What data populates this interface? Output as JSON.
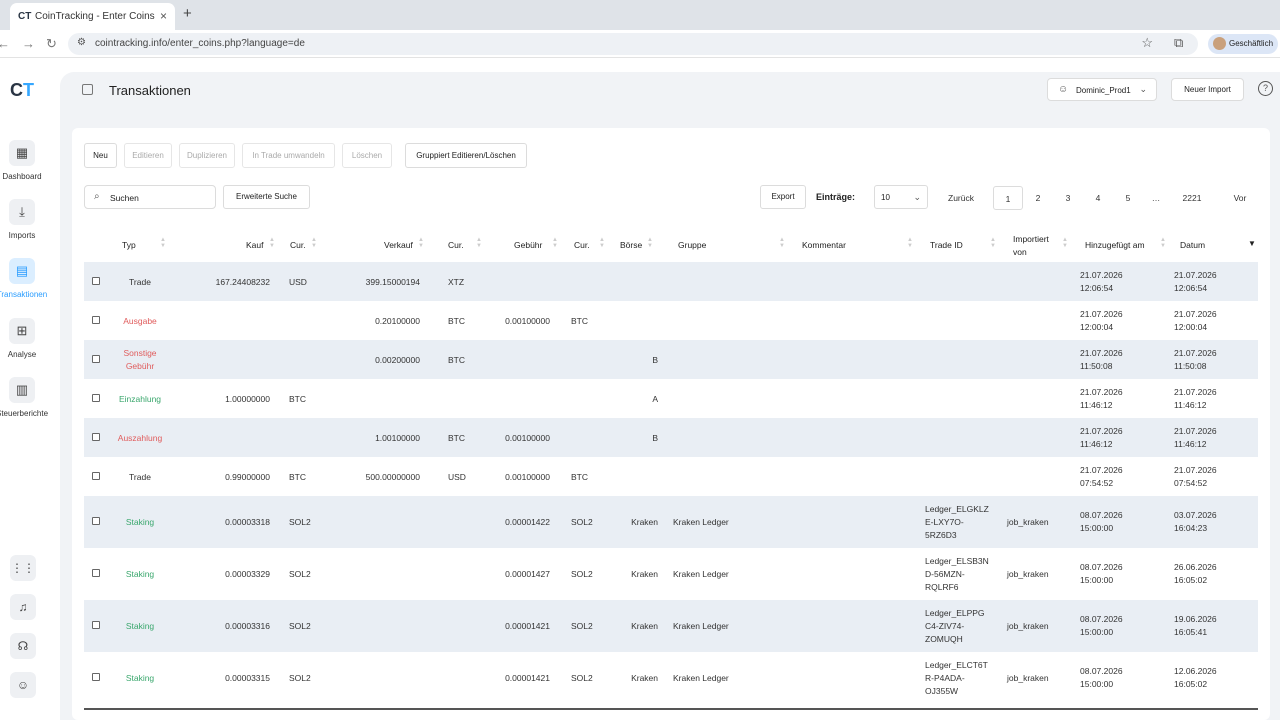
{
  "browser": {
    "tab_title": "CoinTracking - Enter Coins",
    "tab_favicon": "CT",
    "url": "cointracking.info/enter_coins.php?language=de",
    "profile_label": "Geschäftlich"
  },
  "app": {
    "logo_c": "C",
    "logo_t": "T",
    "page_title": "Transaktionen",
    "user_name": "Dominic_Prod1",
    "new_import_label": "Neuer Import",
    "help_label": "?",
    "accent_color": "#35a7ff"
  },
  "sidebar": {
    "items": [
      {
        "label": "Dashboard",
        "icon": "dashboard-grid-icon"
      },
      {
        "label": "Imports",
        "icon": "download-icon"
      },
      {
        "label": "Transaktionen",
        "icon": "transactions-icon"
      },
      {
        "label": "Analyse",
        "icon": "chart-presentation-icon"
      },
      {
        "label": "Steuerberichte",
        "icon": "bar-chart-icon"
      }
    ],
    "bottom_icons": [
      "apps-grid-icon",
      "bell-icon",
      "headset-icon",
      "user-icon"
    ]
  },
  "toolbar": {
    "new": "Neu",
    "edit": "Editieren",
    "duplicate": "Duplizieren",
    "convert": "In Trade umwandeln",
    "delete": "Löschen",
    "group_edit": "Gruppiert Editieren/Löschen",
    "search_placeholder": "Suchen",
    "advanced_search": "Erweiterte Suche",
    "export": "Export",
    "entries_label": "Einträge:",
    "entries_value": "10",
    "prev": "Zurück",
    "pages": [
      "1",
      "2",
      "3",
      "4",
      "5",
      "…",
      "2221"
    ],
    "next": "Vor"
  },
  "table": {
    "headers": {
      "type": "Typ",
      "buy": "Kauf",
      "buy_cur": "Cur.",
      "sell": "Verkauf",
      "sell_cur": "Cur.",
      "fee": "Gebühr",
      "fee_cur": "Cur.",
      "exchange": "Börse",
      "group": "Gruppe",
      "comment": "Kommentar",
      "trade_id": "Trade ID",
      "imported_1": "Importiert",
      "imported_2": "von",
      "added": "Hinzugefügt am",
      "date": "Datum"
    },
    "rows": [
      {
        "type": "Trade",
        "type2": "",
        "buy": "167.24408232",
        "buy_cur": "USD",
        "sell": "399.15000194",
        "sell_cur": "XTZ",
        "fee": "",
        "fee_cur": "",
        "exchange": "",
        "group": "",
        "comment": "",
        "tid1": "",
        "tid2": "",
        "tid3": "",
        "imported": "",
        "added_d": "21.07.2026",
        "added_t": "12:06:54",
        "date_d": "21.07.2026",
        "date_t": "12:06:54"
      },
      {
        "type": "Ausgabe",
        "type2": "",
        "buy": "",
        "buy_cur": "",
        "sell": "0.20100000",
        "sell_cur": "BTC",
        "fee": "0.00100000",
        "fee_cur": "BTC",
        "exchange": "",
        "group": "",
        "comment": "",
        "tid1": "",
        "tid2": "",
        "tid3": "",
        "imported": "",
        "added_d": "21.07.2026",
        "added_t": "12:00:04",
        "date_d": "21.07.2026",
        "date_t": "12:00:04"
      },
      {
        "type": "Sonstige",
        "type2": "Gebühr",
        "buy": "",
        "buy_cur": "",
        "sell": "0.00200000",
        "sell_cur": "BTC",
        "fee": "",
        "fee_cur": "",
        "exchange": "B",
        "group": "",
        "comment": "",
        "tid1": "",
        "tid2": "",
        "tid3": "",
        "imported": "",
        "added_d": "21.07.2026",
        "added_t": "11:50:08",
        "date_d": "21.07.2026",
        "date_t": "11:50:08"
      },
      {
        "type": "Einzahlung",
        "type2": "",
        "buy": "1.00000000",
        "buy_cur": "BTC",
        "sell": "",
        "sell_cur": "",
        "fee": "",
        "fee_cur": "",
        "exchange": "A",
        "group": "",
        "comment": "",
        "tid1": "",
        "tid2": "",
        "tid3": "",
        "imported": "",
        "added_d": "21.07.2026",
        "added_t": "11:46:12",
        "date_d": "21.07.2026",
        "date_t": "11:46:12"
      },
      {
        "type": "Auszahlung",
        "type2": "",
        "buy": "",
        "buy_cur": "",
        "sell": "1.00100000",
        "sell_cur": "BTC",
        "fee": "0.00100000",
        "fee_cur": "",
        "exchange": "B",
        "group": "",
        "comment": "",
        "tid1": "",
        "tid2": "",
        "tid3": "",
        "imported": "",
        "added_d": "21.07.2026",
        "added_t": "11:46:12",
        "date_d": "21.07.2026",
        "date_t": "11:46:12"
      },
      {
        "type": "Trade",
        "type2": "",
        "buy": "0.99000000",
        "buy_cur": "BTC",
        "sell": "500.00000000",
        "sell_cur": "USD",
        "fee": "0.00100000",
        "fee_cur": "BTC",
        "exchange": "",
        "group": "",
        "comment": "",
        "tid1": "",
        "tid2": "",
        "tid3": "",
        "imported": "",
        "added_d": "21.07.2026",
        "added_t": "07:54:52",
        "date_d": "21.07.2026",
        "date_t": "07:54:52"
      },
      {
        "type": "Staking",
        "type2": "",
        "buy": "0.00003318",
        "buy_cur": "SOL2",
        "sell": "",
        "sell_cur": "",
        "fee": "0.00001422",
        "fee_cur": "SOL2",
        "exchange": "Kraken",
        "group": "Kraken Ledger",
        "comment": "",
        "tid1": "Ledger_ELGKLZ",
        "tid2": "E-LXY7O-",
        "tid3": "5RZ6D3",
        "imported": "job_kraken",
        "added_d": "08.07.2026",
        "added_t": "15:00:00",
        "date_d": "03.07.2026",
        "date_t": "16:04:23"
      },
      {
        "type": "Staking",
        "type2": "",
        "buy": "0.00003329",
        "buy_cur": "SOL2",
        "sell": "",
        "sell_cur": "",
        "fee": "0.00001427",
        "fee_cur": "SOL2",
        "exchange": "Kraken",
        "group": "Kraken Ledger",
        "comment": "",
        "tid1": "Ledger_ELSB3N",
        "tid2": "D-56MZN-",
        "tid3": "RQLRF6",
        "imported": "job_kraken",
        "added_d": "08.07.2026",
        "added_t": "15:00:00",
        "date_d": "26.06.2026",
        "date_t": "16:05:02"
      },
      {
        "type": "Staking",
        "type2": "",
        "buy": "0.00003316",
        "buy_cur": "SOL2",
        "sell": "",
        "sell_cur": "",
        "fee": "0.00001421",
        "fee_cur": "SOL2",
        "exchange": "Kraken",
        "group": "Kraken Ledger",
        "comment": "",
        "tid1": "Ledger_ELPPG",
        "tid2": "C4-ZIV74-",
        "tid3": "ZOMUQH",
        "imported": "job_kraken",
        "added_d": "08.07.2026",
        "added_t": "15:00:00",
        "date_d": "19.06.2026",
        "date_t": "16:05:41"
      },
      {
        "type": "Staking",
        "type2": "",
        "buy": "0.00003315",
        "buy_cur": "SOL2",
        "sell": "",
        "sell_cur": "",
        "fee": "0.00001421",
        "fee_cur": "SOL2",
        "exchange": "Kraken",
        "group": "Kraken Ledger",
        "comment": "",
        "tid1": "Ledger_ELCT6T",
        "tid2": "R-P4ADA-",
        "tid3": "OJ355W",
        "imported": "job_kraken",
        "added_d": "08.07.2026",
        "added_t": "15:00:00",
        "date_d": "12.06.2026",
        "date_t": "16:05:02"
      }
    ]
  }
}
